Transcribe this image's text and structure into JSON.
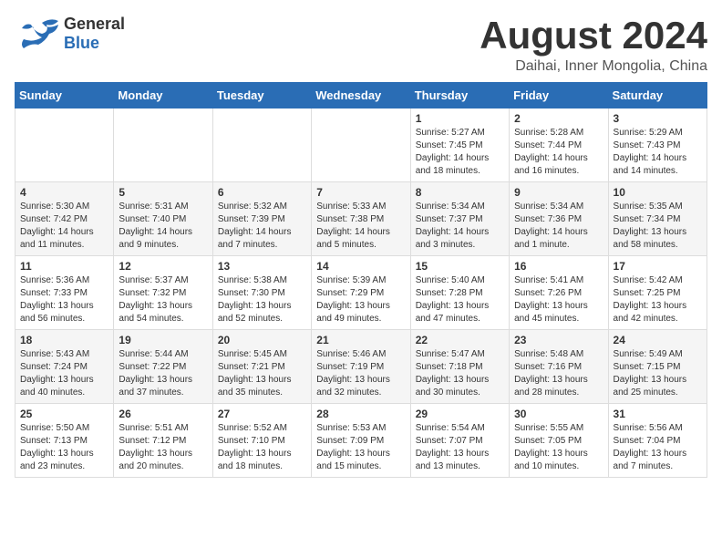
{
  "header": {
    "logo_general": "General",
    "logo_blue": "Blue",
    "month_title": "August 2024",
    "location": "Daihai, Inner Mongolia, China"
  },
  "weekdays": [
    "Sunday",
    "Monday",
    "Tuesday",
    "Wednesday",
    "Thursday",
    "Friday",
    "Saturday"
  ],
  "weeks": [
    [
      {
        "day": "",
        "info": ""
      },
      {
        "day": "",
        "info": ""
      },
      {
        "day": "",
        "info": ""
      },
      {
        "day": "",
        "info": ""
      },
      {
        "day": "1",
        "info": "Sunrise: 5:27 AM\nSunset: 7:45 PM\nDaylight: 14 hours\nand 18 minutes."
      },
      {
        "day": "2",
        "info": "Sunrise: 5:28 AM\nSunset: 7:44 PM\nDaylight: 14 hours\nand 16 minutes."
      },
      {
        "day": "3",
        "info": "Sunrise: 5:29 AM\nSunset: 7:43 PM\nDaylight: 14 hours\nand 14 minutes."
      }
    ],
    [
      {
        "day": "4",
        "info": "Sunrise: 5:30 AM\nSunset: 7:42 PM\nDaylight: 14 hours\nand 11 minutes."
      },
      {
        "day": "5",
        "info": "Sunrise: 5:31 AM\nSunset: 7:40 PM\nDaylight: 14 hours\nand 9 minutes."
      },
      {
        "day": "6",
        "info": "Sunrise: 5:32 AM\nSunset: 7:39 PM\nDaylight: 14 hours\nand 7 minutes."
      },
      {
        "day": "7",
        "info": "Sunrise: 5:33 AM\nSunset: 7:38 PM\nDaylight: 14 hours\nand 5 minutes."
      },
      {
        "day": "8",
        "info": "Sunrise: 5:34 AM\nSunset: 7:37 PM\nDaylight: 14 hours\nand 3 minutes."
      },
      {
        "day": "9",
        "info": "Sunrise: 5:34 AM\nSunset: 7:36 PM\nDaylight: 14 hours\nand 1 minute."
      },
      {
        "day": "10",
        "info": "Sunrise: 5:35 AM\nSunset: 7:34 PM\nDaylight: 13 hours\nand 58 minutes."
      }
    ],
    [
      {
        "day": "11",
        "info": "Sunrise: 5:36 AM\nSunset: 7:33 PM\nDaylight: 13 hours\nand 56 minutes."
      },
      {
        "day": "12",
        "info": "Sunrise: 5:37 AM\nSunset: 7:32 PM\nDaylight: 13 hours\nand 54 minutes."
      },
      {
        "day": "13",
        "info": "Sunrise: 5:38 AM\nSunset: 7:30 PM\nDaylight: 13 hours\nand 52 minutes."
      },
      {
        "day": "14",
        "info": "Sunrise: 5:39 AM\nSunset: 7:29 PM\nDaylight: 13 hours\nand 49 minutes."
      },
      {
        "day": "15",
        "info": "Sunrise: 5:40 AM\nSunset: 7:28 PM\nDaylight: 13 hours\nand 47 minutes."
      },
      {
        "day": "16",
        "info": "Sunrise: 5:41 AM\nSunset: 7:26 PM\nDaylight: 13 hours\nand 45 minutes."
      },
      {
        "day": "17",
        "info": "Sunrise: 5:42 AM\nSunset: 7:25 PM\nDaylight: 13 hours\nand 42 minutes."
      }
    ],
    [
      {
        "day": "18",
        "info": "Sunrise: 5:43 AM\nSunset: 7:24 PM\nDaylight: 13 hours\nand 40 minutes."
      },
      {
        "day": "19",
        "info": "Sunrise: 5:44 AM\nSunset: 7:22 PM\nDaylight: 13 hours\nand 37 minutes."
      },
      {
        "day": "20",
        "info": "Sunrise: 5:45 AM\nSunset: 7:21 PM\nDaylight: 13 hours\nand 35 minutes."
      },
      {
        "day": "21",
        "info": "Sunrise: 5:46 AM\nSunset: 7:19 PM\nDaylight: 13 hours\nand 32 minutes."
      },
      {
        "day": "22",
        "info": "Sunrise: 5:47 AM\nSunset: 7:18 PM\nDaylight: 13 hours\nand 30 minutes."
      },
      {
        "day": "23",
        "info": "Sunrise: 5:48 AM\nSunset: 7:16 PM\nDaylight: 13 hours\nand 28 minutes."
      },
      {
        "day": "24",
        "info": "Sunrise: 5:49 AM\nSunset: 7:15 PM\nDaylight: 13 hours\nand 25 minutes."
      }
    ],
    [
      {
        "day": "25",
        "info": "Sunrise: 5:50 AM\nSunset: 7:13 PM\nDaylight: 13 hours\nand 23 minutes."
      },
      {
        "day": "26",
        "info": "Sunrise: 5:51 AM\nSunset: 7:12 PM\nDaylight: 13 hours\nand 20 minutes."
      },
      {
        "day": "27",
        "info": "Sunrise: 5:52 AM\nSunset: 7:10 PM\nDaylight: 13 hours\nand 18 minutes."
      },
      {
        "day": "28",
        "info": "Sunrise: 5:53 AM\nSunset: 7:09 PM\nDaylight: 13 hours\nand 15 minutes."
      },
      {
        "day": "29",
        "info": "Sunrise: 5:54 AM\nSunset: 7:07 PM\nDaylight: 13 hours\nand 13 minutes."
      },
      {
        "day": "30",
        "info": "Sunrise: 5:55 AM\nSunset: 7:05 PM\nDaylight: 13 hours\nand 10 minutes."
      },
      {
        "day": "31",
        "info": "Sunrise: 5:56 AM\nSunset: 7:04 PM\nDaylight: 13 hours\nand 7 minutes."
      }
    ]
  ]
}
